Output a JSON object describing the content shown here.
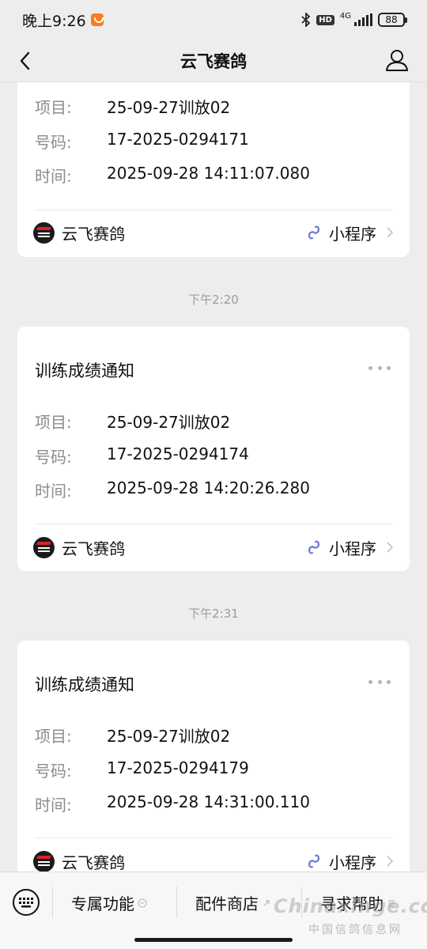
{
  "status_bar": {
    "time": "晚上9:26",
    "hd": "HD",
    "network": "4G",
    "battery": "88"
  },
  "nav": {
    "title": "云飞赛鸽"
  },
  "cards": [
    {
      "fields": [
        {
          "label": "项目:",
          "value": "25-09-27训放02"
        },
        {
          "label": "号码:",
          "value": "17-2025-0294171"
        },
        {
          "label": "时间:",
          "value": "2025-09-28 14:11:07.080"
        }
      ],
      "brand": "云飞赛鸽",
      "mini_program": "小程序"
    },
    {
      "timestamp": "下午2:20",
      "title": "训练成绩通知",
      "fields": [
        {
          "label": "项目:",
          "value": "25-09-27训放02"
        },
        {
          "label": "号码:",
          "value": "17-2025-0294174"
        },
        {
          "label": "时间:",
          "value": "2025-09-28 14:20:26.280"
        }
      ],
      "brand": "云飞赛鸽",
      "mini_program": "小程序"
    },
    {
      "timestamp": "下午2:31",
      "title": "训练成绩通知",
      "fields": [
        {
          "label": "项目:",
          "value": "25-09-27训放02"
        },
        {
          "label": "号码:",
          "value": "17-2025-0294179"
        },
        {
          "label": "时间:",
          "value": "2025-09-28 14:31:00.110"
        }
      ],
      "brand": "云飞赛鸽",
      "mini_program": "小程序"
    }
  ],
  "bottom_menu": {
    "items": [
      {
        "label": "专属功能"
      },
      {
        "label": "配件商店"
      },
      {
        "label": "寻求帮助"
      }
    ]
  },
  "watermark": {
    "en": "Chinaxinge.com",
    "cn": "中国信鸽信息网"
  },
  "colors": {
    "background": "#ededed",
    "card": "#ffffff",
    "mini_program_icon": "#6f7fd6"
  }
}
